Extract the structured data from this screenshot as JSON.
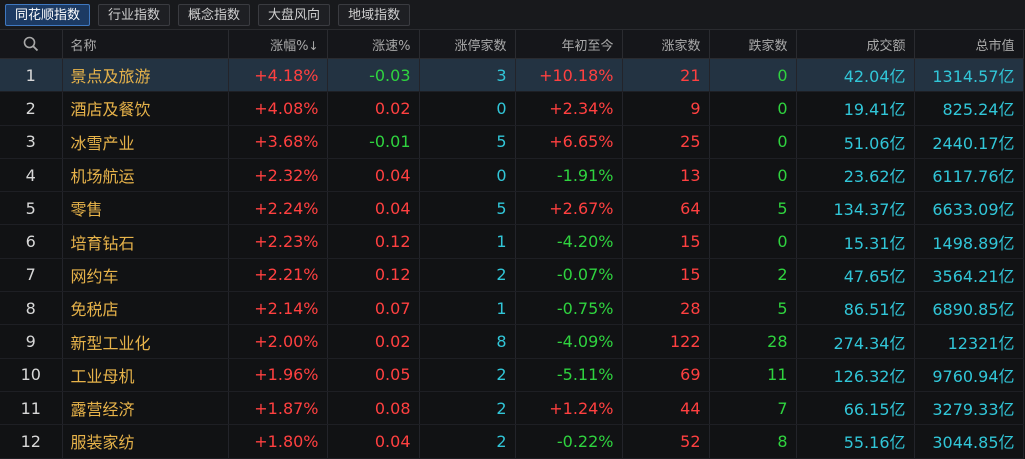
{
  "tabs": [
    "同花顺指数",
    "行业指数",
    "概念指数",
    "大盘风向",
    "地域指数"
  ],
  "columns": {
    "name": "名称",
    "change": "涨幅%",
    "change_sort_icon": "↓",
    "speed": "涨速%",
    "limit_up": "涨停家数",
    "ytd": "年初至今",
    "up": "涨家数",
    "down": "跌家数",
    "volume": "成交额",
    "mktcap": "总市值"
  },
  "rows": [
    {
      "idx": "1",
      "name": "景点及旅游",
      "change": "+4.18%",
      "speed": "-0.03",
      "limit_up": "3",
      "ytd": "+10.18%",
      "up": "21",
      "down": "0",
      "volume": "42.04亿",
      "mktcap": "1314.57亿"
    },
    {
      "idx": "2",
      "name": "酒店及餐饮",
      "change": "+4.08%",
      "speed": "0.02",
      "limit_up": "0",
      "ytd": "+2.34%",
      "up": "9",
      "down": "0",
      "volume": "19.41亿",
      "mktcap": "825.24亿"
    },
    {
      "idx": "3",
      "name": "冰雪产业",
      "change": "+3.68%",
      "speed": "-0.01",
      "limit_up": "5",
      "ytd": "+6.65%",
      "up": "25",
      "down": "0",
      "volume": "51.06亿",
      "mktcap": "2440.17亿"
    },
    {
      "idx": "4",
      "name": "机场航运",
      "change": "+2.32%",
      "speed": "0.04",
      "limit_up": "0",
      "ytd": "-1.91%",
      "up": "13",
      "down": "0",
      "volume": "23.62亿",
      "mktcap": "6117.76亿"
    },
    {
      "idx": "5",
      "name": "零售",
      "change": "+2.24%",
      "speed": "0.04",
      "limit_up": "5",
      "ytd": "+2.67%",
      "up": "64",
      "down": "5",
      "volume": "134.37亿",
      "mktcap": "6633.09亿"
    },
    {
      "idx": "6",
      "name": "培育钻石",
      "change": "+2.23%",
      "speed": "0.12",
      "limit_up": "1",
      "ytd": "-4.20%",
      "up": "15",
      "down": "0",
      "volume": "15.31亿",
      "mktcap": "1498.89亿"
    },
    {
      "idx": "7",
      "name": "网约车",
      "change": "+2.21%",
      "speed": "0.12",
      "limit_up": "2",
      "ytd": "-0.07%",
      "up": "15",
      "down": "2",
      "volume": "47.65亿",
      "mktcap": "3564.21亿"
    },
    {
      "idx": "8",
      "name": "免税店",
      "change": "+2.14%",
      "speed": "0.07",
      "limit_up": "1",
      "ytd": "-0.75%",
      "up": "28",
      "down": "5",
      "volume": "86.51亿",
      "mktcap": "6890.85亿"
    },
    {
      "idx": "9",
      "name": "新型工业化",
      "change": "+2.00%",
      "speed": "0.02",
      "limit_up": "8",
      "ytd": "-4.09%",
      "up": "122",
      "down": "28",
      "volume": "274.34亿",
      "mktcap": "12321亿"
    },
    {
      "idx": "10",
      "name": "工业母机",
      "change": "+1.96%",
      "speed": "0.05",
      "limit_up": "2",
      "ytd": "-5.11%",
      "up": "69",
      "down": "11",
      "volume": "126.32亿",
      "mktcap": "9760.94亿"
    },
    {
      "idx": "11",
      "name": "露营经济",
      "change": "+1.87%",
      "speed": "0.08",
      "limit_up": "2",
      "ytd": "+1.24%",
      "up": "44",
      "down": "7",
      "volume": "66.15亿",
      "mktcap": "3279.33亿"
    },
    {
      "idx": "12",
      "name": "服装家纺",
      "change": "+1.80%",
      "speed": "0.04",
      "limit_up": "2",
      "ytd": "-0.22%",
      "up": "52",
      "down": "8",
      "volume": "55.16亿",
      "mktcap": "3044.85亿"
    }
  ],
  "colors": {
    "up": "#ff4040",
    "down": "#2fd33f",
    "neutral": "#31c6d8",
    "name": "#e7b34a",
    "selected_row": "#233342",
    "active_tab": "#1c3a63"
  }
}
